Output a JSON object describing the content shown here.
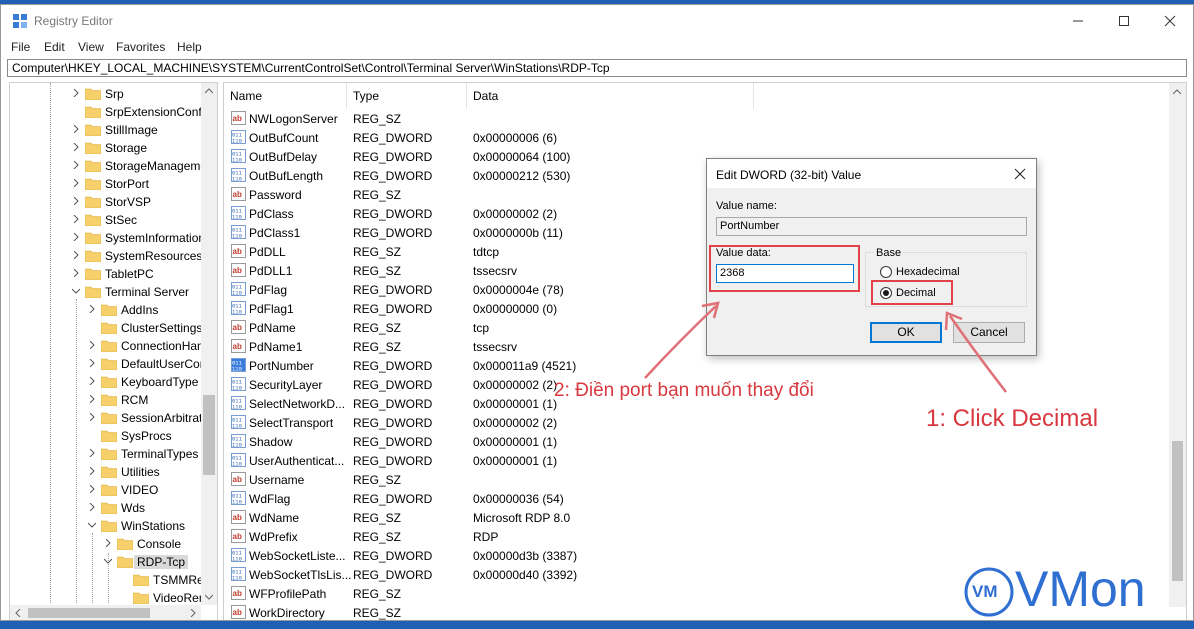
{
  "window": {
    "title": "Registry Editor"
  },
  "menu": [
    "File",
    "Edit",
    "View",
    "Favorites",
    "Help"
  ],
  "address": "Computer\\HKEY_LOCAL_MACHINE\\SYSTEM\\CurrentControlSet\\Control\\Terminal Server\\WinStations\\RDP-Tcp",
  "tree": [
    {
      "label": "Srp",
      "level": 0,
      "expand": "collapsed"
    },
    {
      "label": "SrpExtensionConfi",
      "level": 0,
      "expand": "none"
    },
    {
      "label": "StillImage",
      "level": 0,
      "expand": "collapsed"
    },
    {
      "label": "Storage",
      "level": 0,
      "expand": "collapsed"
    },
    {
      "label": "StorageManageme",
      "level": 0,
      "expand": "collapsed"
    },
    {
      "label": "StorPort",
      "level": 0,
      "expand": "collapsed"
    },
    {
      "label": "StorVSP",
      "level": 0,
      "expand": "collapsed"
    },
    {
      "label": "StSec",
      "level": 0,
      "expand": "collapsed"
    },
    {
      "label": "SystemInformation",
      "level": 0,
      "expand": "collapsed"
    },
    {
      "label": "SystemResources",
      "level": 0,
      "expand": "collapsed"
    },
    {
      "label": "TabletPC",
      "level": 0,
      "expand": "collapsed"
    },
    {
      "label": "Terminal Server",
      "level": 0,
      "expand": "expanded"
    },
    {
      "label": "AddIns",
      "level": 1,
      "expand": "collapsed"
    },
    {
      "label": "ClusterSettings",
      "level": 1,
      "expand": "none"
    },
    {
      "label": "ConnectionHan",
      "level": 1,
      "expand": "collapsed"
    },
    {
      "label": "DefaultUserCon",
      "level": 1,
      "expand": "collapsed"
    },
    {
      "label": "KeyboardType M",
      "level": 1,
      "expand": "collapsed"
    },
    {
      "label": "RCM",
      "level": 1,
      "expand": "collapsed"
    },
    {
      "label": "SessionArbitrati",
      "level": 1,
      "expand": "collapsed"
    },
    {
      "label": "SysProcs",
      "level": 1,
      "expand": "none"
    },
    {
      "label": "TerminalTypes",
      "level": 1,
      "expand": "collapsed"
    },
    {
      "label": "Utilities",
      "level": 1,
      "expand": "collapsed"
    },
    {
      "label": "VIDEO",
      "level": 1,
      "expand": "collapsed"
    },
    {
      "label": "Wds",
      "level": 1,
      "expand": "collapsed"
    },
    {
      "label": "WinStations",
      "level": 1,
      "expand": "expanded"
    },
    {
      "label": "Console",
      "level": 2,
      "expand": "collapsed"
    },
    {
      "label": "RDP-Tcp",
      "level": 2,
      "expand": "expanded",
      "selected": true
    },
    {
      "label": "TSMMRer",
      "level": 3,
      "expand": "none"
    },
    {
      "label": "VideoRen",
      "level": 3,
      "expand": "none"
    }
  ],
  "columns": {
    "name": "Name",
    "type": "Type",
    "data": "Data"
  },
  "values": [
    {
      "name": "NWLogonServer",
      "type": "REG_SZ",
      "data": "",
      "kind": "sz"
    },
    {
      "name": "OutBufCount",
      "type": "REG_DWORD",
      "data": "0x00000006 (6)",
      "kind": "bin"
    },
    {
      "name": "OutBufDelay",
      "type": "REG_DWORD",
      "data": "0x00000064 (100)",
      "kind": "bin"
    },
    {
      "name": "OutBufLength",
      "type": "REG_DWORD",
      "data": "0x00000212 (530)",
      "kind": "bin"
    },
    {
      "name": "Password",
      "type": "REG_SZ",
      "data": "",
      "kind": "sz"
    },
    {
      "name": "PdClass",
      "type": "REG_DWORD",
      "data": "0x00000002 (2)",
      "kind": "bin"
    },
    {
      "name": "PdClass1",
      "type": "REG_DWORD",
      "data": "0x0000000b (11)",
      "kind": "bin"
    },
    {
      "name": "PdDLL",
      "type": "REG_SZ",
      "data": "tdtcp",
      "kind": "sz"
    },
    {
      "name": "PdDLL1",
      "type": "REG_SZ",
      "data": "tssecsrv",
      "kind": "sz"
    },
    {
      "name": "PdFlag",
      "type": "REG_DWORD",
      "data": "0x0000004e (78)",
      "kind": "bin"
    },
    {
      "name": "PdFlag1",
      "type": "REG_DWORD",
      "data": "0x00000000 (0)",
      "kind": "bin"
    },
    {
      "name": "PdName",
      "type": "REG_SZ",
      "data": "tcp",
      "kind": "sz"
    },
    {
      "name": "PdName1",
      "type": "REG_SZ",
      "data": "tssecsrv",
      "kind": "sz"
    },
    {
      "name": "PortNumber",
      "type": "REG_DWORD",
      "data": "0x000011a9 (4521)",
      "kind": "bin-selected"
    },
    {
      "name": "SecurityLayer",
      "type": "REG_DWORD",
      "data": "0x00000002 (2)",
      "kind": "bin"
    },
    {
      "name": "SelectNetworkD...",
      "type": "REG_DWORD",
      "data": "0x00000001 (1)",
      "kind": "bin"
    },
    {
      "name": "SelectTransport",
      "type": "REG_DWORD",
      "data": "0x00000002 (2)",
      "kind": "bin"
    },
    {
      "name": "Shadow",
      "type": "REG_DWORD",
      "data": "0x00000001 (1)",
      "kind": "bin"
    },
    {
      "name": "UserAuthenticat...",
      "type": "REG_DWORD",
      "data": "0x00000001 (1)",
      "kind": "bin"
    },
    {
      "name": "Username",
      "type": "REG_SZ",
      "data": "",
      "kind": "sz"
    },
    {
      "name": "WdFlag",
      "type": "REG_DWORD",
      "data": "0x00000036 (54)",
      "kind": "bin"
    },
    {
      "name": "WdName",
      "type": "REG_SZ",
      "data": "Microsoft RDP 8.0",
      "kind": "sz"
    },
    {
      "name": "WdPrefix",
      "type": "REG_SZ",
      "data": "RDP",
      "kind": "sz"
    },
    {
      "name": "WebSocketListe...",
      "type": "REG_DWORD",
      "data": "0x00000d3b (3387)",
      "kind": "bin"
    },
    {
      "name": "WebSocketTlsLis...",
      "type": "REG_DWORD",
      "data": "0x00000d40 (3392)",
      "kind": "bin"
    },
    {
      "name": "WFProfilePath",
      "type": "REG_SZ",
      "data": "",
      "kind": "sz"
    },
    {
      "name": "WorkDirectory",
      "type": "REG_SZ",
      "data": "",
      "kind": "sz"
    }
  ],
  "dialog": {
    "title": "Edit DWORD (32-bit) Value",
    "value_name_label": "Value name:",
    "value_name": "PortNumber",
    "value_data_label": "Value data:",
    "value_data": "2368",
    "base_label": "Base",
    "hex_label": "Hexadecimal",
    "dec_label": "Decimal",
    "ok": "OK",
    "cancel": "Cancel"
  },
  "annotations": {
    "step2": "2: Điền port bạn muốn thay đổi",
    "step1": "1: Click Decimal"
  },
  "logo": {
    "text": "VMon",
    "badge": "VM"
  },
  "colors": {
    "annotation": "#d8383f",
    "accent": "#0078d7",
    "logo": "#2f6fd1",
    "folder": "#f6d06b"
  }
}
